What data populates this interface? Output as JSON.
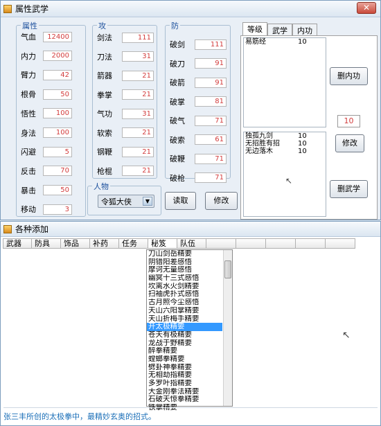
{
  "window1": {
    "title": "属性武学",
    "close": "✕",
    "attr_group": {
      "label": "属性",
      "fields": [
        {
          "label": "气血",
          "value": "12400"
        },
        {
          "label": "内力",
          "value": "2000"
        },
        {
          "label": "臂力",
          "value": "42"
        },
        {
          "label": "根骨",
          "value": "50"
        },
        {
          "label": "悟性",
          "value": "100"
        },
        {
          "label": "身法",
          "value": "100"
        },
        {
          "label": "闪避",
          "value": "5"
        },
        {
          "label": "反击",
          "value": "70"
        },
        {
          "label": "暴击",
          "value": "50"
        },
        {
          "label": "移动",
          "value": "3"
        }
      ]
    },
    "atk_group": {
      "label": "攻",
      "fields": [
        {
          "label": "剑法",
          "value": "111"
        },
        {
          "label": "刀法",
          "value": "31"
        },
        {
          "label": "箭器",
          "value": "21"
        },
        {
          "label": "拳掌",
          "value": "21"
        },
        {
          "label": "气功",
          "value": "31"
        },
        {
          "label": "软索",
          "value": "21"
        },
        {
          "label": "钢鞭",
          "value": "21"
        },
        {
          "label": "枪棍",
          "value": "21"
        }
      ]
    },
    "def_group": {
      "label": "防",
      "fields": [
        {
          "label": "破剑",
          "value": "111"
        },
        {
          "label": "破刀",
          "value": "91"
        },
        {
          "label": "破箭",
          "value": "91"
        },
        {
          "label": "破掌",
          "value": "81"
        },
        {
          "label": "破气",
          "value": "71"
        },
        {
          "label": "破索",
          "value": "61"
        },
        {
          "label": "破鞭",
          "value": "71"
        },
        {
          "label": "破枪",
          "value": "71"
        }
      ]
    },
    "char_group": {
      "label": "人物",
      "selected": "令狐大侠"
    },
    "read_button": "读取",
    "modify_button": "修改",
    "tabs": [
      "等级",
      "武学",
      "内功"
    ],
    "neigong_list": [
      {
        "name": "易筋经",
        "level": "10"
      }
    ],
    "delete_neigong_button": "删内功",
    "level_value": "10",
    "modify_level_button": "修改",
    "wuxue_list": [
      {
        "name": "独孤九剑",
        "level": "10"
      },
      {
        "name": "无招胜有招",
        "level": "10"
      },
      {
        "name": "无边落木",
        "level": "10"
      }
    ],
    "delete_wuxue_button": "删武学"
  },
  "window2": {
    "title": "各种添加",
    "columns": [
      "武器",
      "防具",
      "饰品",
      "补药",
      "任务",
      "秘笈",
      "队伍"
    ],
    "selected_column": "秘笈",
    "list": [
      "刀山剑岳精要",
      "阴错阳差感悟",
      "摩诃无量感悟",
      "幽冥十三式感悟",
      "坎离水火剑精要",
      "扫袖虎扑式感悟",
      "古月照今尘感悟",
      "天山六阳掌精要",
      "天山折梅手精要",
      "开太极精要",
      "苍天有极精要",
      "龙战于野精要",
      "醉拳精要",
      "螳螂拳精要",
      "劈卦神拳精要",
      "无相劫指精要",
      "多罗叶指精要",
      "大金刚拳法精要",
      "石破天惊拳精要",
      "铁掌精要"
    ],
    "selected_item": "开太极精要",
    "status": "张三丰所创的太极拳中，最精妙玄奥的招式。"
  }
}
